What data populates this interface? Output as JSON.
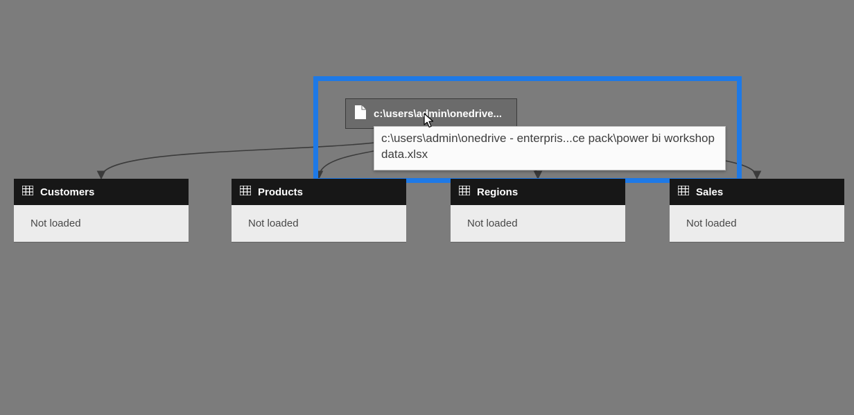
{
  "source": {
    "label": "c:\\users\\admin\\onedrive...",
    "tooltip": "c:\\users\\admin\\onedrive - enterpris...ce pack\\power bi workshop data.xlsx"
  },
  "tables": [
    {
      "name": "Customers",
      "status": "Not loaded"
    },
    {
      "name": "Products",
      "status": "Not loaded"
    },
    {
      "name": "Regions",
      "status": "Not loaded"
    },
    {
      "name": "Sales",
      "status": "Not loaded"
    }
  ]
}
